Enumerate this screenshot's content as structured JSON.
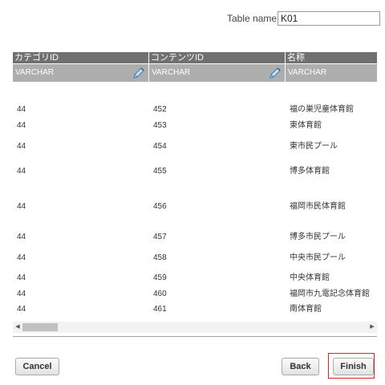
{
  "table_name": {
    "label": "Table name",
    "value": "K01"
  },
  "columns": [
    {
      "header": "カテゴリID",
      "type": "VARCHAR"
    },
    {
      "header": "コンテンツID",
      "type": "VARCHAR"
    },
    {
      "header": "名称",
      "type": "VARCHAR"
    }
  ],
  "rows": [
    {
      "category_id": "44",
      "content_id": "452",
      "name": "福の巣児童体育館"
    },
    {
      "category_id": "44",
      "content_id": "453",
      "name": "東体育館"
    },
    {
      "category_id": "44",
      "content_id": "454",
      "name": "東市民プール"
    },
    {
      "category_id": "44",
      "content_id": "455",
      "name": "博多体育館"
    },
    {
      "category_id": "44",
      "content_id": "456",
      "name": "福岡市民体育館"
    },
    {
      "category_id": "44",
      "content_id": "457",
      "name": "博多市民プール"
    },
    {
      "category_id": "44",
      "content_id": "458",
      "name": "中央市民プール"
    },
    {
      "category_id": "44",
      "content_id": "459",
      "name": "中央体育館"
    },
    {
      "category_id": "44",
      "content_id": "460",
      "name": "福岡市九電記念体育館"
    },
    {
      "category_id": "44",
      "content_id": "461",
      "name": "南体育館"
    }
  ],
  "buttons": {
    "cancel": "Cancel",
    "back": "Back",
    "finish": "Finish"
  },
  "icons": {
    "edit": "pencil-icon",
    "scroll_left": "arrow-left-icon",
    "scroll_right": "arrow-right-icon"
  },
  "colors": {
    "header_bg": "#707070",
    "type_bg": "#aeaeae",
    "highlight": "#e02020"
  }
}
